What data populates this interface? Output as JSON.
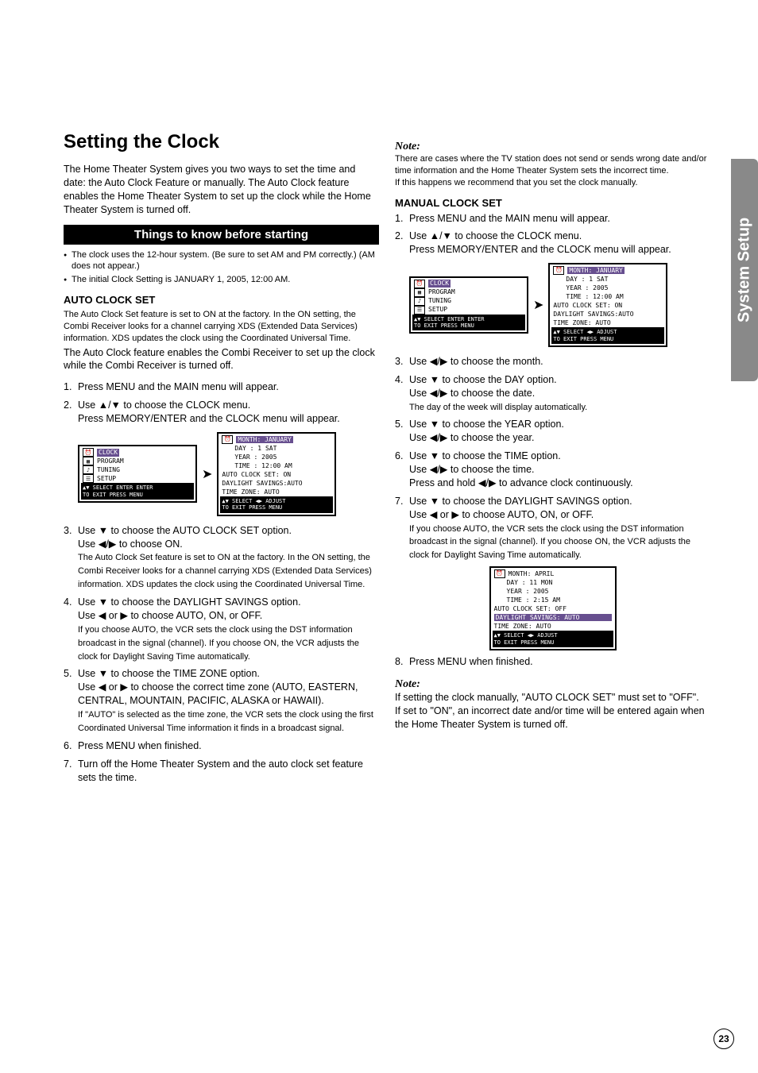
{
  "sideTab": "System Setup",
  "pageNumber": "23",
  "left": {
    "h1": "Setting the Clock",
    "intro": "The Home Theater System  gives you two ways to set the time and date: the Auto Clock Feature or manually. The Auto Clock feature enables the Home Theater System  to set up the clock while the Home Theater System  is turned off.",
    "thingsHeading": "Things to know before starting",
    "bullets": [
      "The clock uses the 12-hour system. (Be sure to set AM and PM correctly.) (AM does not appear.)",
      "The initial Clock Setting is JANUARY 1, 2005, 12:00 AM."
    ],
    "autoHeading": "AUTO CLOCK SET",
    "autoPara1": "The Auto Clock Set feature is set to ON at the factory. In the ON setting, the Combi Receiver looks for a channel carrying XDS (Extended Data Services) information. XDS updates the clock using the Coordinated Universal Time.",
    "autoPara2": "The Auto Clock feature enables the Combi Receiver to set up the clock while the Combi Receiver is turned off.",
    "steps": [
      {
        "n": "1.",
        "main": "Press MENU and the MAIN menu will appear."
      },
      {
        "n": "2.",
        "main": "Use ▲/▼ to choose the CLOCK menu.",
        "main2": "Press MEMORY/ENTER and the CLOCK menu will appear."
      },
      {
        "n": "3.",
        "main": "Use ▼ to choose the AUTO CLOCK SET option.",
        "main2": "Use ◀/▶ to choose ON.",
        "sub": "The Auto Clock Set feature is set to ON at the factory. In the ON setting, the Combi Receiver looks for a channel carrying XDS (Extended Data Services) information. XDS updates the clock using the Coordinated Universal Time."
      },
      {
        "n": "4.",
        "main": "Use ▼ to choose the DAYLIGHT SAVINGS option.",
        "main2": "Use ◀ or ▶ to choose AUTO, ON, or OFF.",
        "sub": "If you choose AUTO, the VCR sets the clock using the DST information broadcast in the signal (channel). If you choose ON, the VCR adjusts the clock for Daylight Saving Time automatically."
      },
      {
        "n": "5.",
        "main": "Use ▼ to choose the TIME ZONE option.",
        "main2": "Use ◀ or ▶ to choose the correct time zone (AUTO, EASTERN, CENTRAL, MOUNTAIN, PACIFIC, ALASKA or HAWAII).",
        "sub": "If \"AUTO\" is selected as the time zone, the VCR sets the clock using the first Coordinated Universal Time information it finds in a broadcast signal."
      },
      {
        "n": "6.",
        "main": "Press MENU when finished."
      },
      {
        "n": "7.",
        "main": "Turn off the Home Theater System  and the auto clock set feature sets the time."
      }
    ],
    "menuA": {
      "items": [
        "CLOCK",
        "PROGRAM",
        "TUNING",
        "SETUP"
      ],
      "footer1": "▲▼ SELECT ENTER ENTER",
      "footer2": "TO EXIT PRESS MENU"
    },
    "menuB": {
      "titleRow": "MONTH: JANUARY",
      "rows": [
        "DAY   :   1 SAT",
        "YEAR  : 2005",
        "TIME  : 12:00 AM",
        "AUTO CLOCK SET:   ON",
        "DAYLIGHT SAVINGS:AUTO",
        "TIME ZONE:      AUTO"
      ],
      "footer1": "▲▼ SELECT  ◀▶ ADJUST",
      "footer2": "TO EXIT PRESS MENU"
    }
  },
  "right": {
    "noteLabel": "Note:",
    "notePara1": "There are cases where the TV station does not send or sends wrong date and/or time information and the Home Theater System  sets the incorrect time.",
    "notePara2": "If this happens we recommend that you set the clock manually.",
    "manualHeading": "MANUAL CLOCK SET",
    "steps1": [
      {
        "n": "1.",
        "main": "Press MENU and the MAIN menu will appear."
      },
      {
        "n": "2.",
        "main": "Use ▲/▼ to choose the CLOCK menu.",
        "main2": "Press MEMORY/ENTER and the CLOCK menu will appear."
      }
    ],
    "menuA": {
      "items": [
        "CLOCK",
        "PROGRAM",
        "TUNING",
        "SETUP"
      ],
      "footer1": "▲▼ SELECT ENTER ENTER",
      "footer2": "TO EXIT PRESS MENU"
    },
    "menuB": {
      "titleRow": "MONTH: JANUARY",
      "rows": [
        "DAY   :   1 SAT",
        "YEAR  : 2005",
        "TIME  : 12:00 AM",
        "AUTO CLOCK SET:   ON",
        "DAYLIGHT SAVINGS:AUTO",
        "TIME ZONE:      AUTO"
      ],
      "footer1": "▲▼ SELECT  ◀▶ ADJUST",
      "footer2": "TO EXIT PRESS MENU"
    },
    "steps2": [
      {
        "n": "3.",
        "main": "Use ◀/▶ to choose the month."
      },
      {
        "n": "4.",
        "main": "Use ▼ to choose the DAY option.",
        "main2": "Use ◀/▶ to choose the date.",
        "sub": "The day of the week will display automatically."
      },
      {
        "n": "5.",
        "main": "Use ▼ to choose the YEAR option.",
        "main2": "Use ◀/▶ to choose the year."
      },
      {
        "n": "6.",
        "main": "Use ▼ to choose the TIME option.",
        "main2": "Use ◀/▶ to choose the time.",
        "main3": "Press and hold ◀/▶ to advance clock continuously."
      },
      {
        "n": "7.",
        "main": "Use ▼ to choose the DAYLIGHT SAVINGS option.",
        "main2": "Use ◀ or ▶ to choose AUTO, ON, or OFF.",
        "sub": "If you choose AUTO, the VCR sets the clock using the DST information broadcast in the signal (channel). If you choose ON, the VCR adjusts the clock for Daylight Saving Time automatically."
      }
    ],
    "menuC": {
      "rows": [
        "MONTH: APRIL",
        "DAY   : 11 MON",
        "YEAR  : 2005",
        "TIME  :  2:15 AM",
        "AUTO CLOCK SET:  OFF"
      ],
      "selRow": "DAYLIGHT SAVINGS: AUTO",
      "afterSel": "TIME ZONE:      AUTO",
      "footer1": "▲▼ SELECT  ◀▶ ADJUST",
      "footer2": "TO EXIT PRESS MENU"
    },
    "step8": {
      "n": "8.",
      "main": "Press MENU when finished."
    },
    "note2Label": "Note:",
    "note2p1": " If setting the clock manually, \"AUTO CLOCK SET\" must set to \"OFF\".",
    "note2p2": "If set to \"ON\", an incorrect date and/or time will be entered again when the Home Theater System is turned off."
  }
}
